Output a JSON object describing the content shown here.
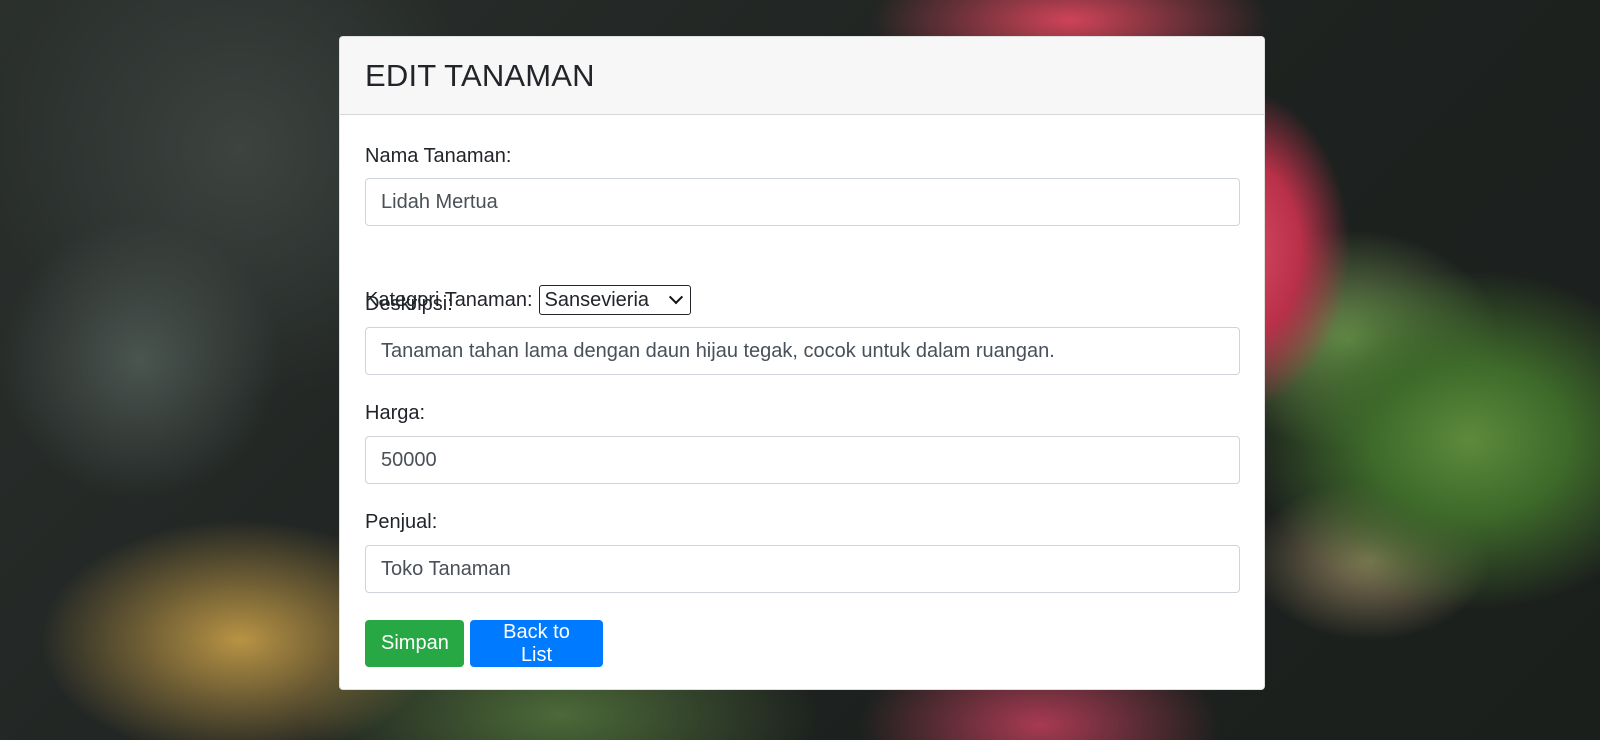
{
  "page": {
    "title": "EDIT TANAMAN"
  },
  "form": {
    "nama_label": "Nama Tanaman:",
    "nama_value": "Lidah Mertua",
    "kategori_label": "Kategori Tanaman:",
    "kategori_selected": "Sansevieria",
    "deskripsi_label": "Deskripsi:",
    "deskripsi_value": "Tanaman tahan lama dengan daun hijau tegak, cocok untuk dalam ruangan.",
    "harga_label": "Harga:",
    "harga_value": "50000",
    "penjual_label": "Penjual:",
    "penjual_value": "Toko Tanaman"
  },
  "buttons": {
    "save_label": "Simpan",
    "back_label": "Back to List"
  },
  "colors": {
    "save": "#28a745",
    "back": "#007bff",
    "header_bg": "#f7f7f7"
  }
}
